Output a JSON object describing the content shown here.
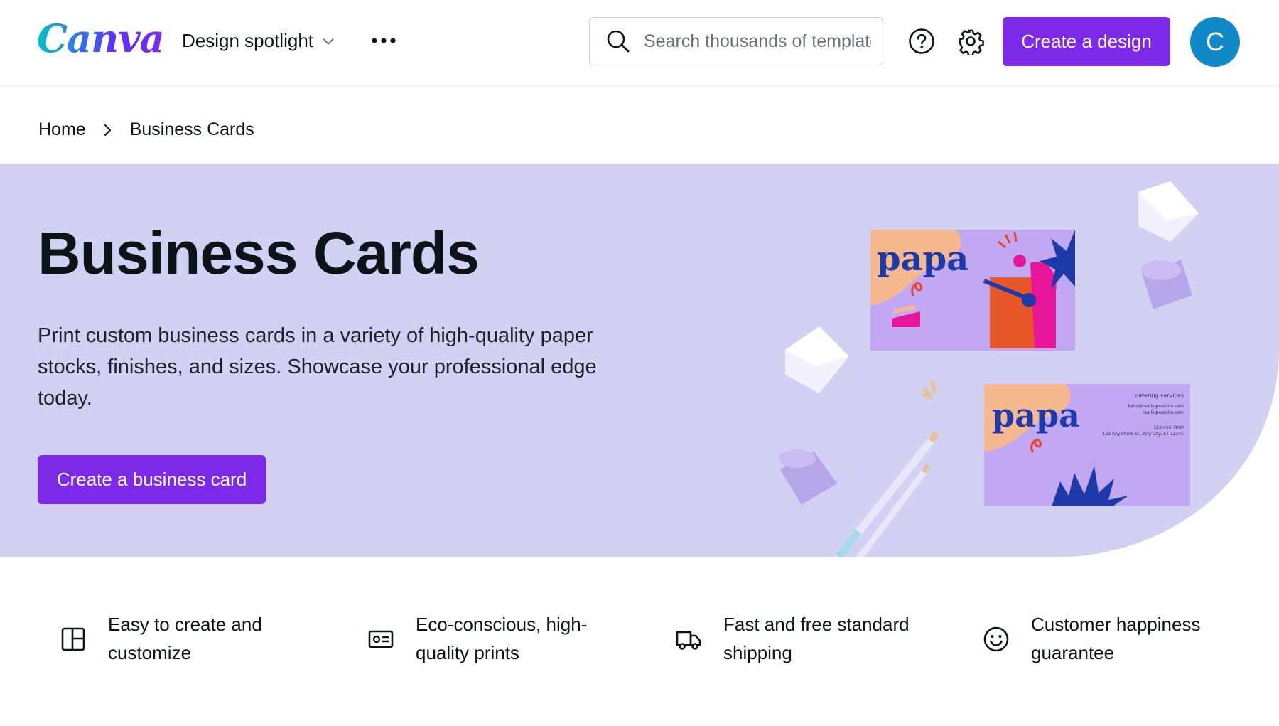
{
  "header": {
    "logo": "Canva",
    "nav_item": "Design spotlight",
    "search_placeholder": "Search thousands of templates",
    "cta_label": "Create a design",
    "avatar_initial": "C"
  },
  "breadcrumb": {
    "home": "Home",
    "current": "Business Cards"
  },
  "hero": {
    "title": "Business Cards",
    "description": "Print custom business cards in a variety of high-quality paper stocks, finishes, and sizes. Showcase your professional edge today.",
    "button_label": "Create a business card",
    "card_brand": "papa",
    "card_tagline": "catering services",
    "card_email": "hello@reallygreatsite.com",
    "card_site": "reallygreatsite.com",
    "card_phone": "123-456-7890",
    "card_address": "123 Anywhere St., Any City, ST 12345"
  },
  "features": [
    {
      "icon": "template-icon",
      "label_line1": "Easy to create and",
      "label_line2": "customize"
    },
    {
      "icon": "card-icon",
      "label_line1": "Eco-conscious, high-",
      "label_line2": "quality prints"
    },
    {
      "icon": "truck-icon",
      "label_line1": "Fast and free standard",
      "label_line2": "shipping"
    },
    {
      "icon": "smiley-icon",
      "label_line1": "Customer happiness",
      "label_line2": "guarantee"
    }
  ],
  "colors": {
    "brand_purple": "#7d2ae8",
    "hero_bg": "#d3d1f3",
    "avatar": "#1189c7"
  }
}
